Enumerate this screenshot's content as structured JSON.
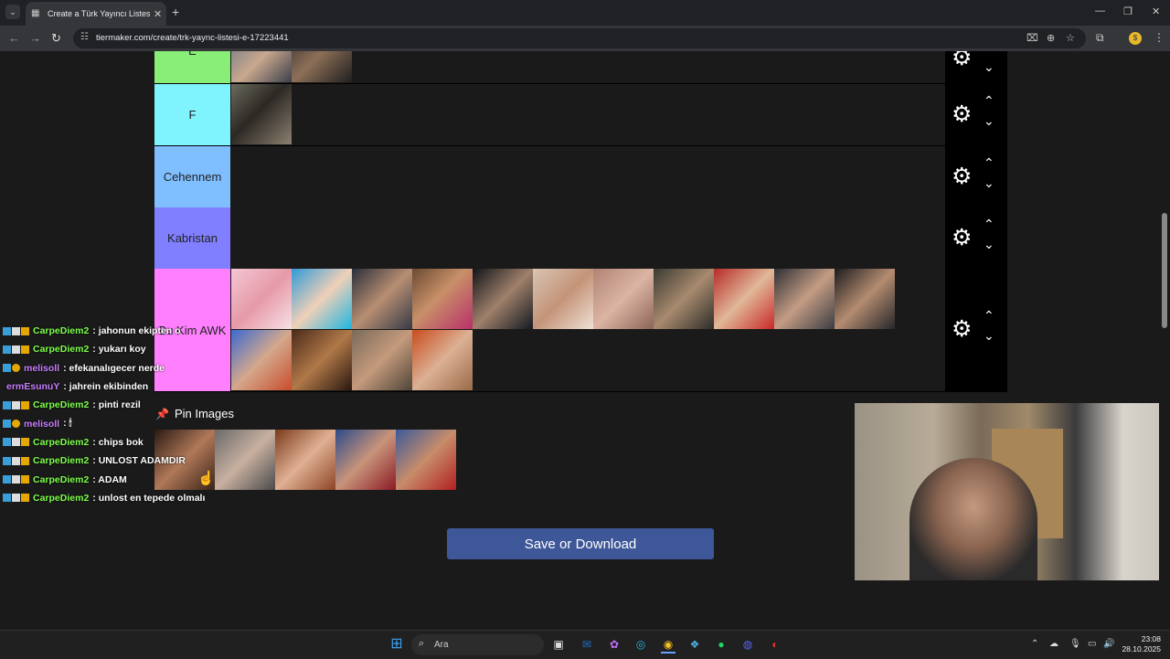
{
  "browser": {
    "tab_title": "Create a Türk Yayıncı Listesi E.Ş",
    "url": "tiermaker.com/create/trk-yaync-listesi-e-17223441"
  },
  "tiers": [
    {
      "label": "E",
      "color": "#88ee77",
      "items": 2
    },
    {
      "label": "F",
      "color": "#7ff4ff",
      "items": 1
    },
    {
      "label": "Cehennem",
      "color": "#7fbfff",
      "items": 0
    },
    {
      "label": "Kabristan",
      "color": "#7f7fff",
      "items": 0
    },
    {
      "label": "Bu Kim AWK",
      "color": "#ff7fff",
      "items": 15
    }
  ],
  "pin": {
    "label": "Pin Images"
  },
  "save_label": "Save or Download",
  "chat": [
    {
      "user": "CarpeDiem2",
      "color": "#7dff4a",
      "text": ": jahonun ekipten o",
      "badges": [
        "b1",
        "b2",
        "b3"
      ]
    },
    {
      "user": "CarpeDiem2",
      "color": "#7dff4a",
      "text": ": yukarı koy",
      "badges": [
        "b1",
        "b2",
        "b3"
      ]
    },
    {
      "user": "melisoll",
      "color": "#c77dff",
      "text": ": efekanalıgecer nerde",
      "badges": [
        "b1",
        "b4"
      ]
    },
    {
      "user": "ermEsunuY",
      "color": "#c77dff",
      "text": ": jahrein ekibinden",
      "badges": []
    },
    {
      "user": "CarpeDiem2",
      "color": "#7dff4a",
      "text": ": pinti rezil",
      "badges": [
        "b1",
        "b2",
        "b3"
      ]
    },
    {
      "user": "melisoll",
      "color": "#c77dff",
      "text": ": 🕯",
      "badges": [
        "b1",
        "b4"
      ]
    },
    {
      "user": "CarpeDiem2",
      "color": "#7dff4a",
      "text": ": chips bok",
      "badges": [
        "b1",
        "b2",
        "b3"
      ]
    },
    {
      "user": "CarpeDiem2",
      "color": "#7dff4a",
      "text": ": UNLOST ADAMDIR",
      "badges": [
        "b1",
        "b2",
        "b3"
      ]
    },
    {
      "user": "CarpeDiem2",
      "color": "#7dff4a",
      "text": ": ADAM",
      "badges": [
        "b1",
        "b2",
        "b3"
      ]
    },
    {
      "user": "CarpeDiem2",
      "color": "#7dff4a",
      "text": ": unlost en tepede olmalı",
      "badges": [
        "b1",
        "b2",
        "b3"
      ]
    }
  ],
  "taskbar": {
    "search_placeholder": "Ara",
    "time": "23:08",
    "date": "28.10.2025"
  }
}
